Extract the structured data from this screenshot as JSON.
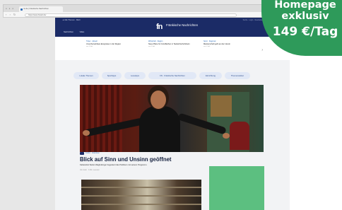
{
  "browser": {
    "tab_title": "nn.de | Fränkische Nachrichten",
    "address": "https://www.fnweb.de/",
    "nav_glyphs": "‹ › ↻",
    "window_dots": "● ● ●"
  },
  "site": {
    "top_left": "◄ Alle Themen  ·  Mehr",
    "top_right": "Suche  ·  Login  ·  Newsletter  ·  Abo",
    "logo_mark": "fn",
    "logo_text": "Fränkische Nachrichten",
    "nav_items": [
      "Nachrichten",
      "Video"
    ]
  },
  "ticker": [
    {
      "kicker": "Ticker · Aktuell",
      "title": "Unvorhersehbare Ereignisse in der Region",
      "meta": "vor 3 Std."
    },
    {
      "kicker": "Wirtschaft · Region",
      "title": "Neue Pläne für Grünflächen in Tauberbischofsheim",
      "meta": "vor 4 Std."
    },
    {
      "kicker": "Sport · Regional",
      "title": "Meisterschaft geht an den Verein",
      "meta": "vor 5 Std."
    }
  ],
  "ticker_chevron": "›",
  "ressorts": [
    "Lokale Themen",
    "Sporttipps",
    "Lesetipps",
    "FN · Fränkische Nachrichten",
    "Einrichtung",
    "Themenwelten"
  ],
  "article": {
    "kicker": "Kultur · Interview",
    "title": "Blick auf Sinn und Unsinn geöffnet",
    "subtitle": "Kabarettist Stefan Waghubinger begeistert das Publikum mit seinem Programm.",
    "byline": "Von Autor · 3 Min. Lesezeit"
  },
  "promo_badge": {
    "line1": "Homepage",
    "line2": "exklusiv",
    "line3": "149 €/Tag",
    "color": "#2e9a5a"
  },
  "colors": {
    "header_bg": "#1b2b66",
    "ad_box": "#5cbf80",
    "pill_bg": "#e1e8f6"
  }
}
